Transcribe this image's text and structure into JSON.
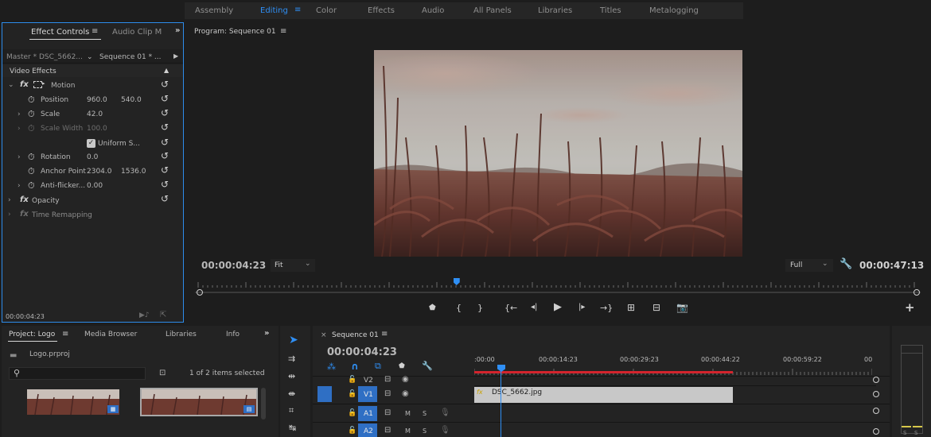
{
  "workspaces": {
    "items": [
      "Assembly",
      "Editing",
      "Color",
      "Effects",
      "Audio",
      "All Panels",
      "Libraries",
      "Titles",
      "Metalogging"
    ],
    "active": "Editing"
  },
  "effect_controls": {
    "tab": "Effect Controls",
    "tab2": "Audio Clip M",
    "master": "Master * DSC_5662...",
    "sequence": "Sequence 01 * ...",
    "section": "Video Effects",
    "motion": "Motion",
    "position_label": "Position",
    "position_x": "960.0",
    "position_y": "540.0",
    "scale_label": "Scale",
    "scale_value": "42.0",
    "scale_width_label": "Scale Width",
    "scale_width_value": "100.0",
    "uniform_label": "Uniform S...",
    "rotation_label": "Rotation",
    "rotation_value": "0.0",
    "anchor_label": "Anchor Point",
    "anchor_x": "2304.0",
    "anchor_y": "1536.0",
    "antiflicker_label": "Anti-flicker...",
    "antiflicker_value": "0.00",
    "opacity_label": "Opacity",
    "time_remap_label": "Time Remapping",
    "timecode": "00:00:04:23"
  },
  "program": {
    "title": "Program: Sequence 01",
    "timecode": "00:00:04:23",
    "fit": "Fit",
    "quality": "Full",
    "duration": "00:00:47:13",
    "playhead_fraction": 0.105
  },
  "project": {
    "tab": "Project: Logo",
    "media_browser": "Media Browser",
    "libraries": "Libraries",
    "info": "Info",
    "file": "Logo.prproj",
    "items_count": "1 of 2 items selected"
  },
  "timeline": {
    "tab": "Sequence 01",
    "timecode": "00:00:04:23",
    "ruler": [
      ":00:00",
      "00:00:14:23",
      "00:00:29:23",
      "00:00:44:22",
      "00:00:59:22",
      "00"
    ],
    "tracks": [
      {
        "label": "V2"
      },
      {
        "label": "V1"
      },
      {
        "label": "A1",
        "m": "M",
        "s": "S"
      },
      {
        "label": "A2",
        "m": "M",
        "s": "S"
      }
    ],
    "clip": "DSC_5662.jpg"
  },
  "colors": {
    "accent": "#2f8ff5",
    "panel": "#232323",
    "bg": "#1d1d1d",
    "clip": "#c8c8c8",
    "workarea": "#d3242d"
  }
}
